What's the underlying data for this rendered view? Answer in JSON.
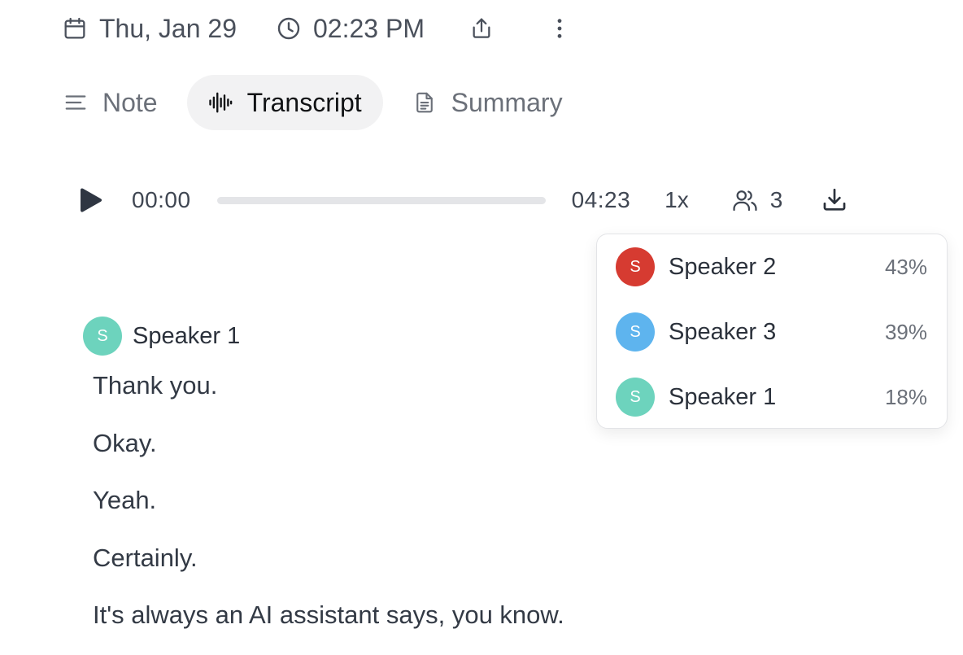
{
  "header": {
    "date": "Thu, Jan 29",
    "time": "02:23 PM",
    "date_icon": "calendar-icon",
    "time_icon": "clock-icon",
    "share_icon": "share-icon",
    "more_icon": "more-vertical-icon"
  },
  "tabs": [
    {
      "label": "Note",
      "icon": "menu-lines-icon",
      "active": false
    },
    {
      "label": "Transcript",
      "icon": "audio-waveform-icon",
      "active": true
    },
    {
      "label": "Summary",
      "icon": "document-icon",
      "active": false
    }
  ],
  "player": {
    "current_time": "00:00",
    "duration": "04:23",
    "progress_fraction": 0,
    "speed": "1x",
    "speaker_count": "3",
    "play_icon": "play-icon",
    "speakers_icon": "users-icon",
    "download_icon": "download-icon"
  },
  "speakers_dropdown": [
    {
      "initial": "S",
      "name": "Speaker 2",
      "percent": "43%",
      "color": "#d63b31"
    },
    {
      "initial": "S",
      "name": "Speaker 3",
      "percent": "39%",
      "color": "#5eb4ee"
    },
    {
      "initial": "S",
      "name": "Speaker 1",
      "percent": "18%",
      "color": "#6dd3bd"
    }
  ],
  "transcript": {
    "speaker": {
      "initial": "S",
      "name": "Speaker 1",
      "color": "#6dd3bd"
    },
    "lines": [
      "Thank you.",
      "Okay.",
      "Yeah.",
      "Certainly.",
      "It's always an AI assistant says, you know."
    ]
  },
  "colors": {
    "active_tab_bg": "#f2f2f3",
    "progress_track": "#e4e5e8",
    "text_primary": "#2b313b",
    "text_secondary": "#6b7079"
  }
}
